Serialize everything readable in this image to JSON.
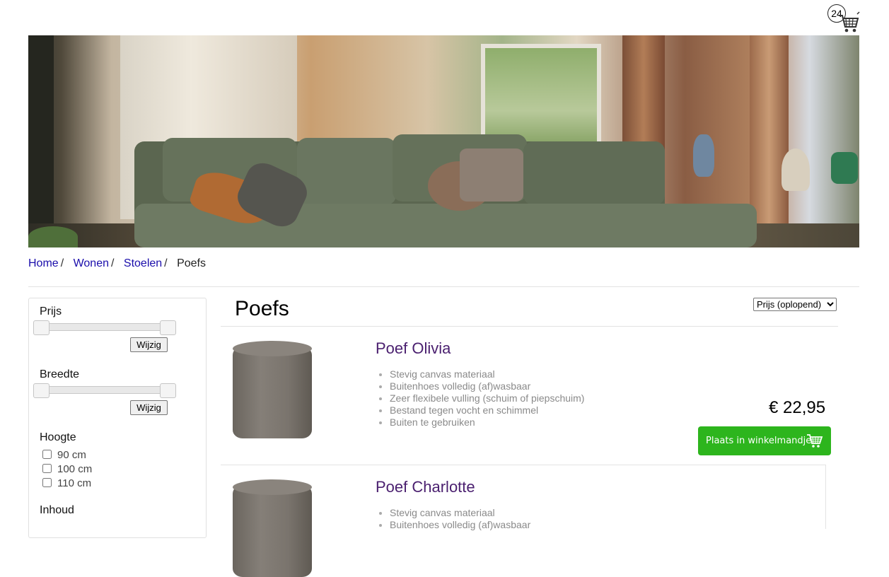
{
  "cart": {
    "count": "24",
    "icon": "cart-icon"
  },
  "hero": {
    "icon": "living-room-photo"
  },
  "breadcrumb": [
    {
      "label": "Home"
    },
    {
      "label": "Wonen"
    },
    {
      "label": "Stoelen"
    },
    {
      "label": "Poefs"
    }
  ],
  "filters": {
    "price": {
      "title": "Prijs",
      "button": "Wijzig"
    },
    "width": {
      "title": "Breedte",
      "button": "Wijzig"
    },
    "height": {
      "title": "Hoogte",
      "options": [
        {
          "label": "90 cm",
          "checked": false
        },
        {
          "label": "100 cm",
          "checked": false
        },
        {
          "label": "110 cm",
          "checked": false
        }
      ]
    },
    "content": {
      "title": "Inhoud"
    }
  },
  "page": {
    "title": "Poefs"
  },
  "sort": {
    "selected": "Prijs (oplopend)"
  },
  "products": [
    {
      "name": "Poef Olivia",
      "features": [
        "Stevig canvas materiaal",
        "Buitenhoes volledig (af)wasbaar",
        "Zeer flexibele vulling (schuim of piepschuim)",
        "Bestand tegen vocht en schimmel",
        "Buiten te gebruiken"
      ],
      "price": "€ 22,95",
      "button": "Plaats in winkelmandje"
    },
    {
      "name": "Poef Charlotte",
      "features": [
        "Stevig canvas materiaal",
        "Buitenhoes volledig (af)wasbaar"
      ]
    }
  ],
  "colors": {
    "link": "#1a0dab",
    "product_name": "#4a1f6f",
    "add_button": "#2db51d",
    "feature_text": "#8a8a8a"
  }
}
